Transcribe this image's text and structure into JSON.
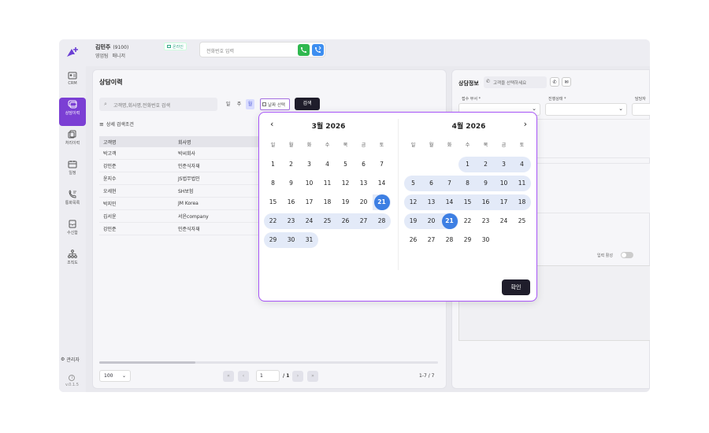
{
  "header": {
    "user_name": "김민주",
    "user_ext": "(9100)",
    "user_dept": "영업팀",
    "user_role": "매니저",
    "status": "온라인",
    "phone_placeholder": "전화번호 입력"
  },
  "sidebar": {
    "items": [
      {
        "label": "CRM",
        "icon": "id-card-icon"
      },
      {
        "label": "상담이력",
        "icon": "chat-icon"
      },
      {
        "label": "처리이력",
        "icon": "copy-icon"
      },
      {
        "label": "일정",
        "icon": "calendar-icon"
      },
      {
        "label": "통화목록",
        "icon": "phone-list-icon"
      },
      {
        "label": "수신함",
        "icon": "inbox-icon"
      },
      {
        "label": "조직도",
        "icon": "org-chart-icon"
      }
    ],
    "admin_label": "관리자",
    "version": "v.0.1.5"
  },
  "history": {
    "title": "상담이력",
    "search_placeholder": "고객명,회사명,전화번호 검색",
    "periods": [
      "일",
      "주",
      "월"
    ],
    "date_select_label": "날짜 선택",
    "search_button": "검색",
    "filter_label": "상세 검색조건",
    "columns": [
      "고객명",
      "회사명"
    ],
    "rows": [
      [
        "박고객",
        "박씨회사"
      ],
      [
        "강민준",
        "민준식자재"
      ],
      [
        "윤지수",
        "JS법무법인"
      ],
      [
        "오세현",
        "SH보험"
      ],
      [
        "박지민",
        "JM Korea"
      ],
      [
        "김서윤",
        "서윤company"
      ],
      [
        "강민준",
        "민준식자재"
      ]
    ],
    "page_size": "100",
    "page_current": "1",
    "page_total": "/ 1",
    "range_text": "1-7 / 7"
  },
  "consult_info": {
    "title": "상담정보",
    "customer_placeholder": "고객을 선택하세요",
    "fields": [
      "접수 부서 *",
      "진행상태 *",
      "담당자"
    ],
    "input_active_label": "입력 활성"
  },
  "date_picker": {
    "months": [
      {
        "title": "3월 2026",
        "weeks": [
          [
            "1",
            "2",
            "3",
            "4",
            "5",
            "6",
            "7"
          ],
          [
            "8",
            "9",
            "10",
            "11",
            "12",
            "13",
            "14"
          ],
          [
            "15",
            "16",
            "17",
            "18",
            "19",
            "20",
            "21"
          ],
          [
            "22",
            "23",
            "24",
            "25",
            "26",
            "27",
            "28"
          ],
          [
            "29",
            "30",
            "31",
            "",
            "",
            "",
            ""
          ]
        ]
      },
      {
        "title": "4월 2026",
        "weeks": [
          [
            "",
            "",
            "",
            "1",
            "2",
            "3",
            "4"
          ],
          [
            "5",
            "6",
            "7",
            "8",
            "9",
            "10",
            "11"
          ],
          [
            "12",
            "13",
            "14",
            "15",
            "16",
            "17",
            "18"
          ],
          [
            "19",
            "20",
            "21",
            "22",
            "23",
            "24",
            "25"
          ],
          [
            "26",
            "27",
            "28",
            "29",
            "30",
            "",
            ""
          ]
        ]
      }
    ],
    "weekdays": [
      "일",
      "월",
      "화",
      "수",
      "목",
      "금",
      "토"
    ],
    "range_start": "3월 21",
    "range_end": "4월 21",
    "confirm_button": "확인",
    "colors": {
      "accent": "#3d7fe3",
      "range": "#e3eaf8",
      "border": "#a855f7"
    }
  }
}
